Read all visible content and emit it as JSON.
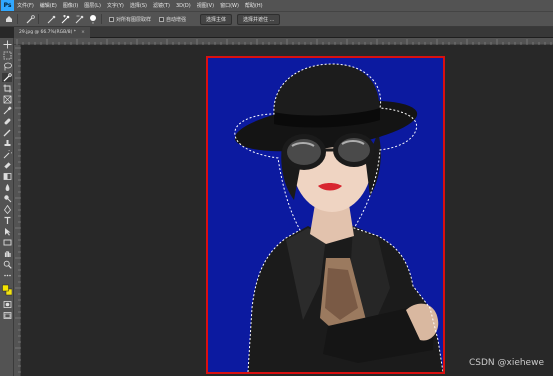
{
  "menubar": {
    "logo": "Ps",
    "items": [
      "文件(F)",
      "编辑(E)",
      "图像(I)",
      "图层(L)",
      "文字(Y)",
      "选择(S)",
      "滤镜(T)",
      "3D(D)",
      "视图(V)",
      "窗口(W)",
      "帮助(H)"
    ]
  },
  "options": {
    "sample_all_layers": "对所有图层取样",
    "auto_enhance": "自动增强",
    "select_subject": "选择主体",
    "select_and_mask": "选择并遮住 ..."
  },
  "document": {
    "tab_title": "29.jpg @ 66.7%(RGB/8) *",
    "close": "×"
  },
  "watermark": "CSDN @xiehewe",
  "colors": {
    "background": "#282828",
    "panel": "#535353",
    "image_bg": "#0d1a9e",
    "border": "#d91010",
    "accent": "#31a8ff"
  }
}
